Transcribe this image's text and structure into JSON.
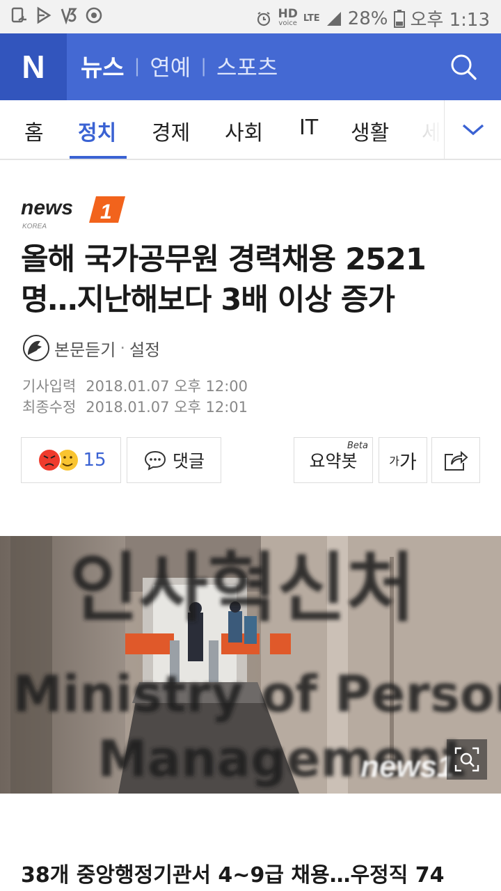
{
  "status_bar": {
    "hd_label": "HD",
    "hd_sub": "voice",
    "lte_label": "LTE",
    "battery": "28%",
    "time": "오후 1:13"
  },
  "header": {
    "logo": "N",
    "nav": [
      "뉴스",
      "연예",
      "스포츠"
    ],
    "brand_color": "#4469d3"
  },
  "tabs": {
    "items": [
      "홈",
      "정치",
      "경제",
      "사회",
      "IT",
      "생활",
      "세"
    ],
    "active_index": 1,
    "accent": "#3a62d3"
  },
  "article": {
    "press_name": "news1",
    "press_sub": "KOREA",
    "headline_line1": "올해 국가공무원 경력채용 2521",
    "headline_line2": "명…지난해보다 3배 이상 증가",
    "listen_label": "본문듣기",
    "settings_label": "설정",
    "input_label": "기사입력",
    "input_time": "2018.01.07 오후 12:00",
    "modified_label": "최종수정",
    "modified_time": "2018.01.07 오후 12:01",
    "reaction_count": "15",
    "comment_label": "댓글",
    "summary_label": "요약봇",
    "summary_beta": "Beta",
    "font_small": "가",
    "font_large": "가",
    "photo_sign_korean": "인사혁신처",
    "photo_sign_english_1": "Ministry of Personnel",
    "photo_sign_english_2": "Management",
    "photo_watermark": "news1",
    "subheadline": "38개 중앙행정기관서 4~9급 채용…우정직 74"
  }
}
